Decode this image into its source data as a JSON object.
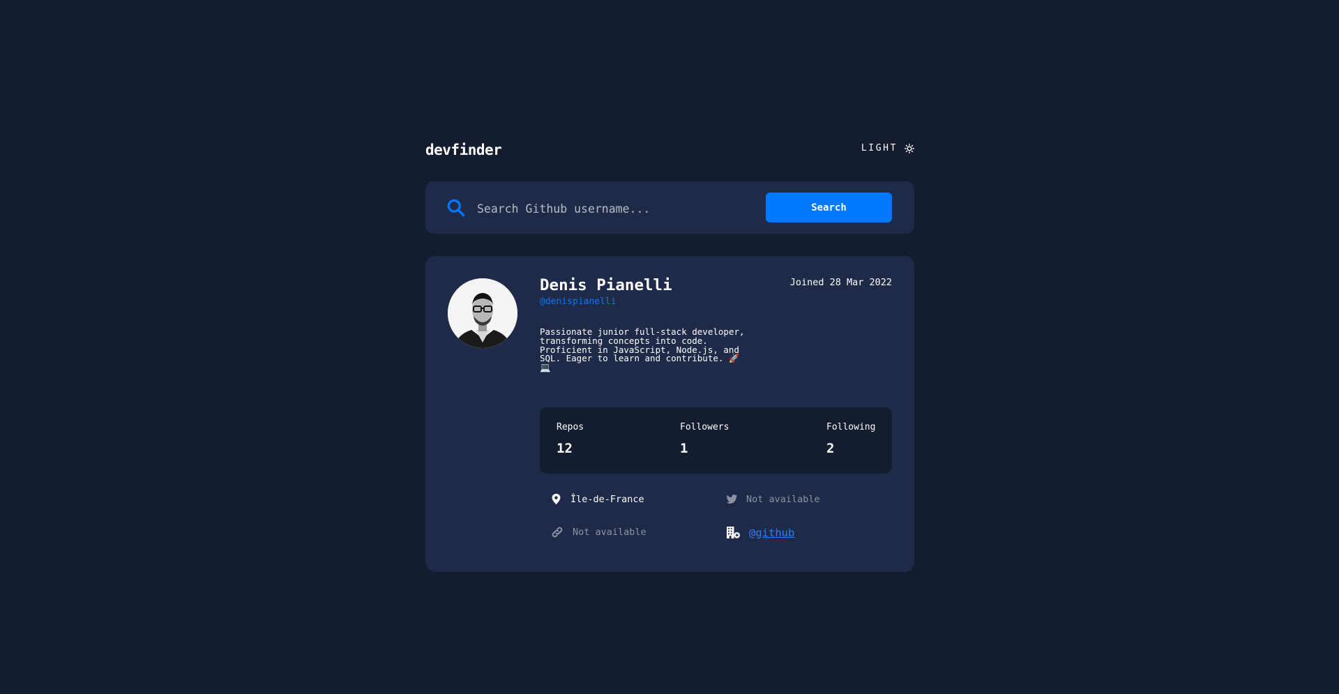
{
  "header": {
    "logo": "devfinder",
    "theme_label": "LIGHT",
    "theme_icon": "sun-icon"
  },
  "search": {
    "placeholder": "Search Github username...",
    "value": "",
    "button_label": "Search",
    "icon": "search-icon"
  },
  "profile": {
    "name": "Denis Pianelli",
    "login": "@denispianelli",
    "joined": "Joined 28 Mar 2022",
    "bio": "Passionate junior full-stack developer, transforming concepts into code. Proficient in JavaScript, Node.js, and SQL. Eager to learn and contribute. 🚀💻",
    "stats": {
      "repos_label": "Repos",
      "repos": "12",
      "followers_label": "Followers",
      "followers": "1",
      "following_label": "Following",
      "following": "2"
    },
    "links": {
      "location": "Île-de-France",
      "twitter": "Not available",
      "blog": "Not available",
      "company": "@github"
    }
  },
  "colors": {
    "background": "#141d2f",
    "card": "#1e2a47",
    "accent": "#0079ff",
    "muted": "#8c93a3"
  }
}
